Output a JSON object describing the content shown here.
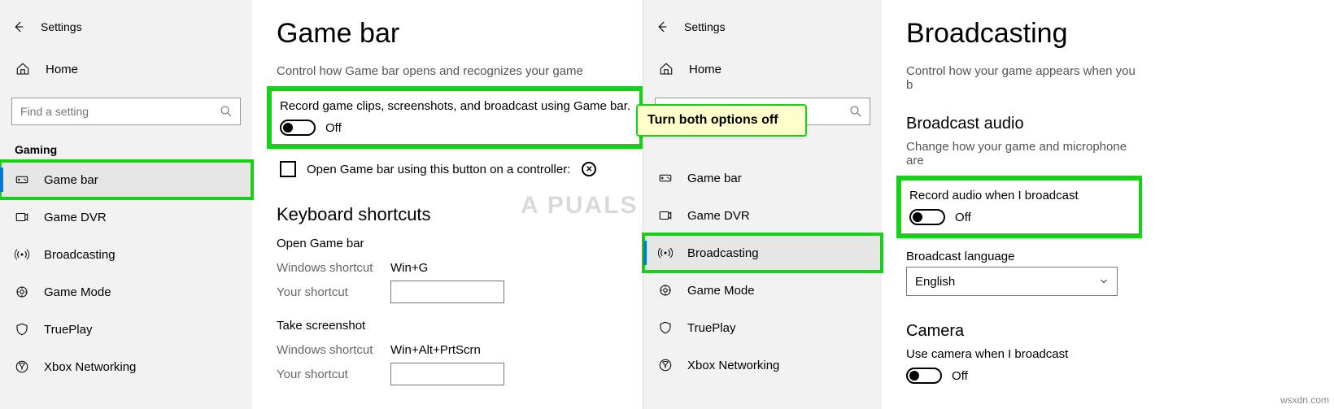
{
  "callout": "Turn both options off",
  "attribution": "wsxdn.com",
  "watermark": "A   PUALS",
  "panes": {
    "left": {
      "app_title": "Settings",
      "home_label": "Home",
      "search_placeholder": "Find a setting",
      "section_title": "Gaming",
      "nav": [
        {
          "label": "Game bar",
          "icon": "gamebar-icon",
          "selected": true,
          "highlight": true
        },
        {
          "label": "Game DVR",
          "icon": "dvr-icon"
        },
        {
          "label": "Broadcasting",
          "icon": "broadcast-icon"
        },
        {
          "label": "Game Mode",
          "icon": "gamemode-icon"
        },
        {
          "label": "TruePlay",
          "icon": "trueplay-icon"
        },
        {
          "label": "Xbox Networking",
          "icon": "xbox-icon"
        }
      ],
      "content": {
        "title": "Game bar",
        "description": "Control how Game bar opens and recognizes your game",
        "primary_setting": {
          "label": "Record game clips, screenshots, and broadcast using Game bar.",
          "state": "Off",
          "highlight": true
        },
        "controller_checkbox_label": "Open Game bar using this button on a controller:",
        "shortcuts_title": "Keyboard shortcuts",
        "open_gamebar": {
          "heading": "Open Game bar",
          "win_label": "Windows shortcut",
          "win_value": "Win+G",
          "your_label": "Your shortcut"
        },
        "take_screenshot": {
          "heading": "Take screenshot",
          "win_label": "Windows shortcut",
          "win_value": "Win+Alt+PrtScrn",
          "your_label": "Your shortcut"
        }
      }
    },
    "right": {
      "app_title": "Settings",
      "home_label": "Home",
      "search_placeholder": "",
      "nav": [
        {
          "label": "Game bar",
          "icon": "gamebar-icon"
        },
        {
          "label": "Game DVR",
          "icon": "dvr-icon"
        },
        {
          "label": "Broadcasting",
          "icon": "broadcast-icon",
          "selected": true,
          "highlight": true
        },
        {
          "label": "Game Mode",
          "icon": "gamemode-icon"
        },
        {
          "label": "TruePlay",
          "icon": "trueplay-icon"
        },
        {
          "label": "Xbox Networking",
          "icon": "xbox-icon"
        }
      ],
      "content": {
        "title": "Broadcasting",
        "description": "Control how your game appears when you b",
        "section1_title": "Broadcast audio",
        "section1_sub": "Change how your game and microphone are",
        "primary_setting": {
          "label": "Record audio when I broadcast",
          "state": "Off",
          "highlight": true
        },
        "language_label": "Broadcast language",
        "language_value": "English",
        "camera_title": "Camera",
        "camera_setting": {
          "label": "Use camera when I broadcast",
          "state": "Off"
        }
      }
    }
  }
}
